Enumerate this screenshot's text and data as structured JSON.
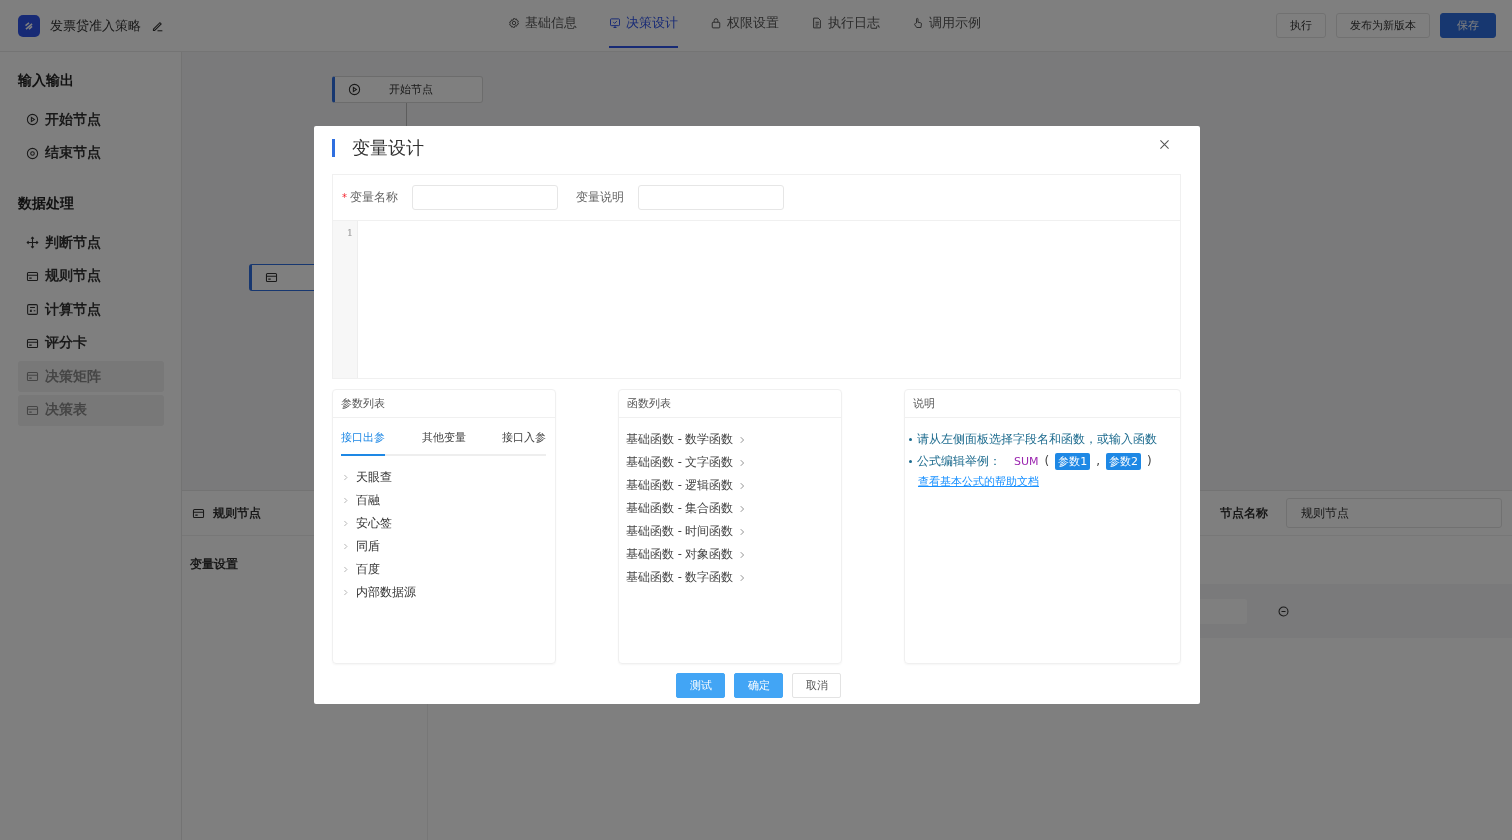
{
  "header": {
    "title": "发票贷准入策略",
    "tabs": [
      {
        "label": "基础信息",
        "selected": false
      },
      {
        "label": "决策设计",
        "selected": true
      },
      {
        "label": "权限设置",
        "selected": false
      },
      {
        "label": "执行日志",
        "selected": false
      },
      {
        "label": "调用示例",
        "selected": false
      }
    ],
    "actions": [
      {
        "label": "执行",
        "kind": "default"
      },
      {
        "label": "发布为新版本",
        "kind": "default"
      },
      {
        "label": "保存",
        "kind": "primary"
      }
    ]
  },
  "sidebar": {
    "groups": [
      {
        "title": "输入输出",
        "items": [
          {
            "label": "开始节点",
            "disabled": false
          },
          {
            "label": "结束节点",
            "disabled": false
          }
        ]
      },
      {
        "title": "数据处理",
        "items": [
          {
            "label": "判断节点",
            "disabled": false
          },
          {
            "label": "规则节点",
            "disabled": false
          },
          {
            "label": "计算节点",
            "disabled": false
          },
          {
            "label": "评分卡",
            "disabled": false
          },
          {
            "label": "决策矩阵",
            "disabled": true
          },
          {
            "label": "决策表",
            "disabled": true
          }
        ]
      }
    ]
  },
  "canvas": {
    "nodes": [
      {
        "kind": "start",
        "label": "开始节点"
      },
      {
        "kind": "rule"
      }
    ]
  },
  "detail": {
    "title": "规则节点",
    "section": "变量设置",
    "node_name_label": "节点名称",
    "node_name_value": "规则节点"
  },
  "modal": {
    "title": "变量设计",
    "fields": [
      {
        "label": "变量名称",
        "required_mark": "*"
      },
      {
        "label": "变量说明"
      }
    ],
    "editor": {
      "line_numbers": [
        "1"
      ]
    },
    "params": {
      "title": "参数列表",
      "tabs": [
        {
          "label": "接口出参",
          "selected": true
        },
        {
          "label": "其他变量",
          "selected": false
        },
        {
          "label": "接口入参",
          "selected": false
        }
      ],
      "items": [
        "天眼查",
        "百融",
        "安心签",
        "同盾",
        "百度",
        "内部数据源"
      ]
    },
    "functions": {
      "title": "函数列表",
      "items": [
        "基础函数 - 数学函数",
        "基础函数 - 文字函数",
        "基础函数 - 逻辑函数",
        "基础函数 - 集合函数",
        "基础函数 - 时间函数",
        "基础函数 - 对象函数",
        "基础函数 - 数字函数"
      ]
    },
    "help": {
      "title": "说明",
      "tip": "请从左侧面板选择字段名和函数，或输入函数",
      "example_label": "公式编辑举例：",
      "example": [
        {
          "kind": "function",
          "text": "SUM"
        },
        {
          "kind": "punct",
          "text": "("
        },
        {
          "kind": "arg",
          "text": "参数1"
        },
        {
          "kind": "punct",
          "text": ","
        },
        {
          "kind": "arg",
          "text": "参数2"
        },
        {
          "kind": "punct",
          "text": ")"
        }
      ],
      "link": "查看基本公式的帮助文档"
    },
    "buttons": [
      {
        "label": "测试",
        "kind": "primary"
      },
      {
        "label": "确定",
        "kind": "primary"
      },
      {
        "label": "取消",
        "kind": "default"
      }
    ]
  }
}
